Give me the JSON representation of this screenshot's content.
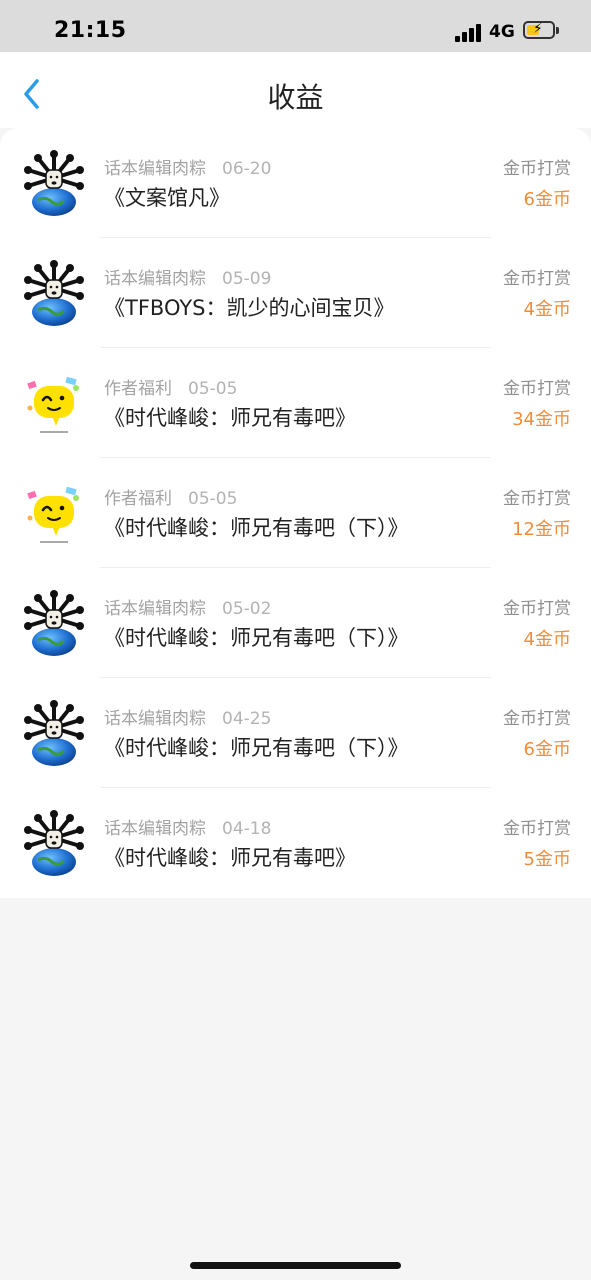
{
  "status_bar": {
    "time": "21:15",
    "network": "4G"
  },
  "header": {
    "title": "收益",
    "back_icon": "chevron-left-icon",
    "accent": "#2a9de8"
  },
  "colors": {
    "amount": "#f28c38",
    "meta": "#a3a3a3"
  },
  "rows": [
    {
      "avatar": "spiky-globe-avatar",
      "source": "话本编辑肉粽",
      "date": "06-20",
      "book": "《文案馆凡》",
      "type": "金币打赏",
      "amount": "6金币"
    },
    {
      "avatar": "spiky-globe-avatar",
      "source": "话本编辑肉粽",
      "date": "05-09",
      "book": "《TFBOYS：凯少的心间宝贝》",
      "type": "金币打赏",
      "amount": "4金币"
    },
    {
      "avatar": "yellow-smiley-avatar",
      "source": "作者福利",
      "date": "05-05",
      "book": "《时代峰峻：师兄有毒吧》",
      "type": "金币打赏",
      "amount": "34金币"
    },
    {
      "avatar": "yellow-smiley-avatar",
      "source": "作者福利",
      "date": "05-05",
      "book": "《时代峰峻：师兄有毒吧（下）》",
      "type": "金币打赏",
      "amount": "12金币"
    },
    {
      "avatar": "spiky-globe-avatar",
      "source": "话本编辑肉粽",
      "date": "05-02",
      "book": "《时代峰峻：师兄有毒吧（下）》",
      "type": "金币打赏",
      "amount": "4金币"
    },
    {
      "avatar": "spiky-globe-avatar",
      "source": "话本编辑肉粽",
      "date": "04-25",
      "book": "《时代峰峻：师兄有毒吧（下）》",
      "type": "金币打赏",
      "amount": "6金币"
    },
    {
      "avatar": "spiky-globe-avatar",
      "source": "话本编辑肉粽",
      "date": "04-18",
      "book": "《时代峰峻：师兄有毒吧》",
      "type": "金币打赏",
      "amount": "5金币"
    }
  ]
}
